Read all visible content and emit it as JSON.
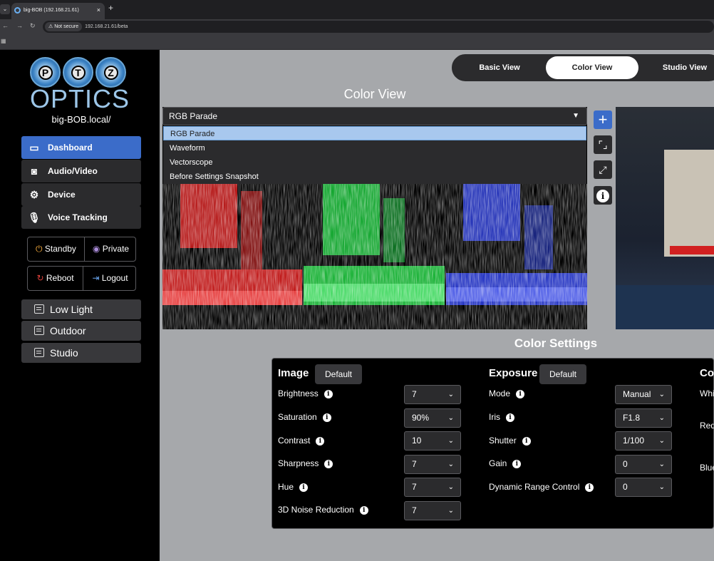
{
  "browser": {
    "tab_title": "big-BOB (192.168.21.61)",
    "tab_close": "×",
    "new_tab": "+",
    "security": "Not secure",
    "url": "192.168.21.61/beta"
  },
  "sidebar": {
    "logo_letters": [
      "P",
      "T",
      "Z"
    ],
    "logo_text": "OPTICS",
    "hostname": "big-BOB.local/",
    "menu": [
      {
        "label": "Dashboard",
        "icon": "video-camera-icon",
        "active": true
      },
      {
        "label": "Audio/Video",
        "icon": "camera-icon",
        "active": false
      },
      {
        "label": "Device",
        "icon": "gear-icon",
        "active": false
      },
      {
        "label": "Voice Tracking",
        "icon": "microphone-icon",
        "active": false
      }
    ],
    "standby": "Standby",
    "private": "Private",
    "reboot": "Reboot",
    "logout": "Logout",
    "presets": [
      "Low Light",
      "Outdoor",
      "Studio"
    ]
  },
  "view_switch": {
    "basic": "Basic View",
    "color": "Color View",
    "studio": "Studio View",
    "active": "Color View"
  },
  "color_view": {
    "title": "Color View",
    "selected": "RGB Parade",
    "options": [
      "RGB Parade",
      "Waveform",
      "Vectorscope",
      "Before Settings Snapshot"
    ],
    "highlighted": "RGB Parade"
  },
  "tools": {
    "add": "+",
    "info": "i"
  },
  "color_settings": {
    "title": "Color Settings",
    "image": {
      "title": "Image",
      "default_label": "Default",
      "rows": [
        {
          "label": "Brightness",
          "value": "7"
        },
        {
          "label": "Saturation",
          "value": "90%"
        },
        {
          "label": "Contrast",
          "value": "10"
        },
        {
          "label": "Sharpness",
          "value": "7"
        },
        {
          "label": "Hue",
          "value": "7"
        },
        {
          "label": "3D Noise Reduction",
          "value": "7"
        }
      ]
    },
    "exposure": {
      "title": "Exposure",
      "default_label": "Default",
      "rows": [
        {
          "label": "Mode",
          "value": "Manual"
        },
        {
          "label": "Iris",
          "value": "F1.8"
        },
        {
          "label": "Shutter",
          "value": "1/100"
        },
        {
          "label": "Gain",
          "value": "0"
        },
        {
          "label": "Dynamic Range Control",
          "value": "0"
        }
      ]
    },
    "color_partial": {
      "title": "Co",
      "labels": [
        "Whi",
        "Red",
        "Blue"
      ]
    }
  },
  "colors": {
    "accent": "#3b6cc9",
    "sidebar_bg": "#000000",
    "page_bg": "#a6a8ab"
  }
}
